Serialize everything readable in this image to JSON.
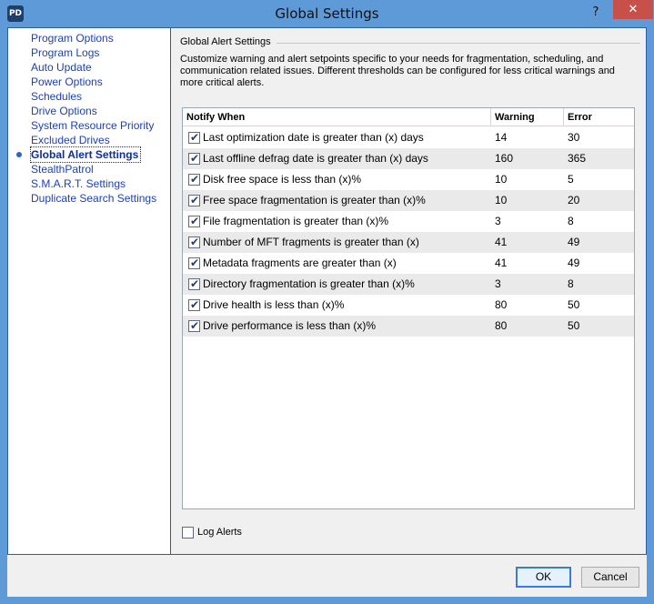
{
  "window": {
    "title": "Global Settings",
    "app_icon_text": "PD",
    "help_label": "?",
    "close_label": "✕",
    "accent_color": "#5f9ad8",
    "close_color": "#c7504a"
  },
  "sidebar": {
    "items": [
      {
        "label": "Program Options"
      },
      {
        "label": "Program Logs"
      },
      {
        "label": "Auto Update"
      },
      {
        "label": "Power Options"
      },
      {
        "label": "Schedules"
      },
      {
        "label": "Drive Options"
      },
      {
        "label": "System Resource Priority"
      },
      {
        "label": "Excluded Drives"
      },
      {
        "label": "Global Alert Settings"
      },
      {
        "label": "StealthPatrol"
      },
      {
        "label": "S.M.A.R.T. Settings"
      },
      {
        "label": "Duplicate Search Settings"
      }
    ],
    "selected": "Global Alert Settings"
  },
  "main": {
    "section_title": "Global Alert Settings",
    "description": "Customize warning and alert setpoints specific to your needs for fragmentation, scheduling, and communication related issues.  Different thresholds can be configured for less critical warnings and more critical alerts.",
    "columns": [
      "Notify When",
      "Warning",
      "Error"
    ],
    "rows": [
      {
        "label": "Last optimization date is greater than (x) days",
        "warning": "14",
        "error": "30",
        "checked": true
      },
      {
        "label": "Last offline defrag date is greater than (x) days",
        "warning": "160",
        "error": "365",
        "checked": true
      },
      {
        "label": "Disk free space is less than (x)%",
        "warning": "10",
        "error": "5",
        "checked": true
      },
      {
        "label": "Free space fragmentation is greater than (x)%",
        "warning": "10",
        "error": "20",
        "checked": true
      },
      {
        "label": "File fragmentation is greater than (x)%",
        "warning": "3",
        "error": "8",
        "checked": true
      },
      {
        "label": "Number of MFT fragments is greater than (x)",
        "warning": "41",
        "error": "49",
        "checked": true
      },
      {
        "label": "Metadata fragments are greater than (x)",
        "warning": "41",
        "error": "49",
        "checked": true
      },
      {
        "label": "Directory fragmentation is greater than (x)%",
        "warning": "3",
        "error": "8",
        "checked": true
      },
      {
        "label": "Drive health is less than (x)%",
        "warning": "80",
        "error": "50",
        "checked": true
      },
      {
        "label": "Drive performance is less than (x)%",
        "warning": "80",
        "error": "50",
        "checked": true
      }
    ],
    "log_alerts_label": "Log Alerts",
    "log_alerts_checked": false
  },
  "footer": {
    "ok_label": "OK",
    "cancel_label": "Cancel"
  }
}
